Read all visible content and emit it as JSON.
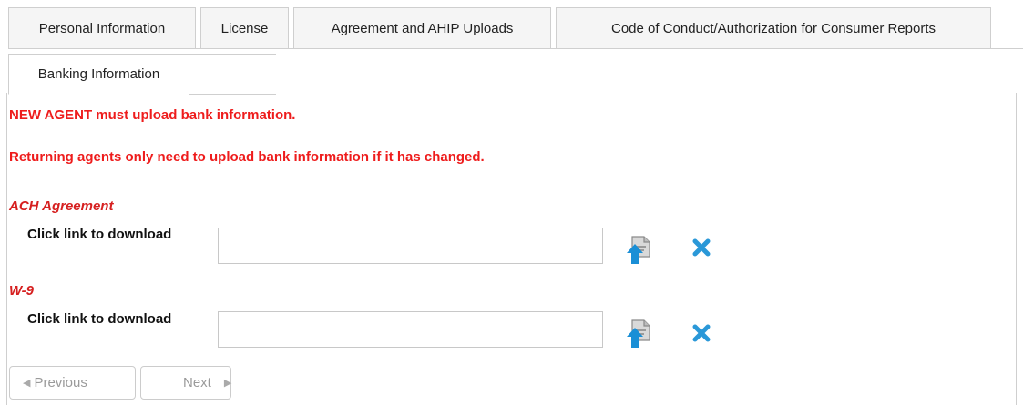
{
  "tabs": [
    {
      "label": "Personal Information"
    },
    {
      "label": "License"
    },
    {
      "label": "Agreement and AHIP Uploads"
    },
    {
      "label": "Code of Conduct/Authorization for Consumer Reports"
    },
    {
      "label": "Banking Information",
      "active": true
    }
  ],
  "notices": {
    "new_agent": "NEW AGENT must upload bank information.",
    "returning": "Returning agents only need to upload bank information if it has changed."
  },
  "sections": [
    {
      "title": "ACH Agreement",
      "download_label": "Click link to download",
      "file_value": "",
      "upload_icon": "upload-file-icon",
      "remove_icon": "close-icon"
    },
    {
      "title": "W-9",
      "download_label": "Click link to download",
      "file_value": "",
      "upload_icon": "upload-file-icon",
      "remove_icon": "close-icon"
    }
  ],
  "navigation": {
    "previous_label": "Previous",
    "next_label": "Next",
    "previous_arrow": "◀",
    "next_arrow": "▶"
  },
  "colors": {
    "notice_red": "#ee1c1c",
    "section_red": "#d62020",
    "icon_blue": "#1a8fd6",
    "close_blue": "#2a98d8"
  }
}
